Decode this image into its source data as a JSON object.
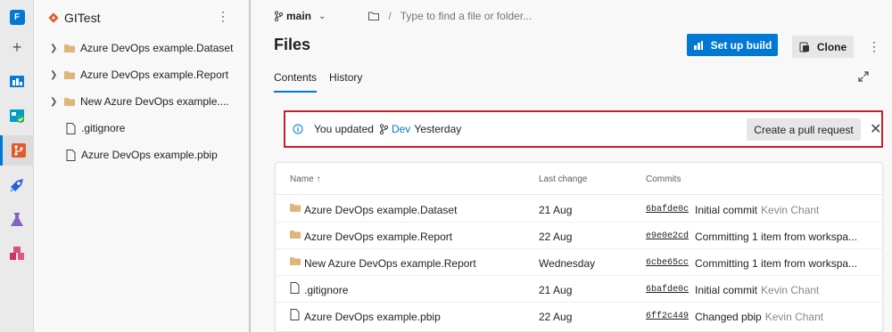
{
  "rail": {
    "org_initial": "F",
    "plus": "+",
    "items": [
      "overview-icon",
      "boards-icon",
      "repos-icon",
      "pipelines-icon",
      "test-plans-icon",
      "artifacts-icon"
    ]
  },
  "sidebar": {
    "repo_name": "GITest",
    "more": "⋮",
    "items": [
      {
        "label": "Azure DevOps example.Dataset",
        "type": "folder"
      },
      {
        "label": "Azure DevOps example.Report",
        "type": "folder"
      },
      {
        "label": "New Azure DevOps example....",
        "type": "folder"
      },
      {
        "label": ".gitignore",
        "type": "file"
      },
      {
        "label": "Azure DevOps example.pbip",
        "type": "file"
      }
    ]
  },
  "header": {
    "branch": "main",
    "path_sep": "/",
    "search_placeholder": "Type to find a file or folder...",
    "title": "Files",
    "setup_build": "Set up build",
    "clone": "Clone",
    "more": "⋮"
  },
  "tabs": [
    {
      "label": "Contents",
      "active": true
    },
    {
      "label": "History",
      "active": false
    }
  ],
  "banner": {
    "prefix": "You updated",
    "branch": "Dev",
    "suffix": "Yesterday",
    "action": "Create a pull request",
    "close": "✕"
  },
  "table": {
    "columns": {
      "name": "Name ↑",
      "last_change": "Last change",
      "commits": "Commits"
    },
    "rows": [
      {
        "type": "folder",
        "name": "Azure DevOps example.Dataset",
        "date": "21 Aug",
        "hash": "6bafde0c",
        "message": "Initial commit",
        "author": "Kevin Chant"
      },
      {
        "type": "folder",
        "name": "Azure DevOps example.Report",
        "date": "22 Aug",
        "hash": "e9e0e2cd",
        "message": "Committing 1 item from workspa...",
        "author": ""
      },
      {
        "type": "folder",
        "name": "New Azure DevOps example.Report",
        "date": "Wednesday",
        "hash": "6cbe65cc",
        "message": "Committing 1 item from workspa...",
        "author": ""
      },
      {
        "type": "file",
        "name": ".gitignore",
        "date": "21 Aug",
        "hash": "6bafde0c",
        "message": "Initial commit",
        "author": "Kevin Chant"
      },
      {
        "type": "file",
        "name": "Azure DevOps example.pbip",
        "date": "22 Aug",
        "hash": "6ff2c449",
        "message": "Changed pbip",
        "author": "Kevin Chant"
      }
    ]
  },
  "colors": {
    "accent": "#0078d4",
    "highlight_border": "#c4212b",
    "folder": "#dcb67a"
  }
}
